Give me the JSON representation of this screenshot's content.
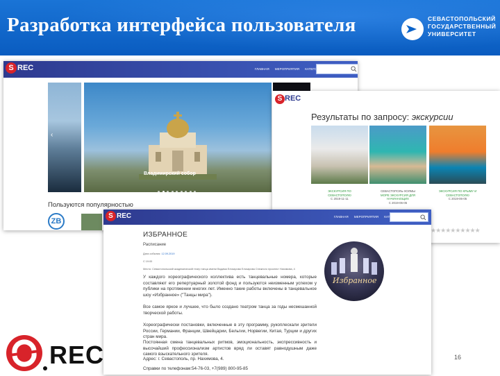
{
  "slide": {
    "title": "Разработка интерфейса пользователя",
    "university_lines": [
      "СЕВАСТОПОЛЬСКИЙ",
      "ГОСУДАРСТВЕННЫЙ",
      "УНИВЕРСИТЕТ"
    ],
    "page_number": "16",
    "footer_logo_text": "REC",
    "colors": {
      "banner": "#0b63c9",
      "nav": "#2e3a8f",
      "logo_red": "#d8232a"
    }
  },
  "shot1": {
    "logo": "REC",
    "nav": [
      "ГЛАВНАЯ",
      "МЕРОПРИЯТИЯ",
      "КАТЕГОРИИ"
    ],
    "hero_caption": "Владимирский собор",
    "section_title": "Пользуются популярностью",
    "popular_logo": "ZB"
  },
  "shot2": {
    "logo": "REC",
    "heading_prefix": "Результаты по запросу: ",
    "heading_query": "экскурсии",
    "results": [
      {
        "title_a": "ЭКСКУРСИЯ ПО",
        "title_b": "СЕВАСТОПОЛЮ",
        "date": "С 2019-11-11"
      },
      {
        "title_a": "СЕВАСТОПОЛЬ-ХОЛМЫ",
        "title_b": "МОРЕ ЭКСКУРСИЯ ДЛЯ НАЧИНАЮЩИХ",
        "date": "С 2019-06-05"
      },
      {
        "title_a": "ЭКСКУРСИЯ ПО КРЫМУ И",
        "title_b": "СЕВАСТОПОЛЮ",
        "date": "С 2019-06-05"
      }
    ],
    "rating_stars": "★★★★★★★★★★"
  },
  "shot3": {
    "logo": "REC",
    "nav": [
      "ГЛАВНАЯ",
      "МЕРОПРИЯТИЯ",
      "КАТЕГОРИИ"
    ],
    "title": "ИЗБРАННОЕ",
    "subtitle": "Расписание",
    "date_label": "Дата события: ",
    "date_value": "12.09.2019",
    "time": "С 19:00",
    "place": "Место: Севастопольский академический театр танца имени Вадима Елизарова Елизарова Снежного проспект Нахимова, 4",
    "paragraphs": [
      "У каждого хореографического коллектива есть танцевальные номера, которые составляют его репертуарный золотой фонд и пользуются неизменным успехом у публики на протяжении многих лет. Именно такие работы включены в танцевальное шоу «Избранное» (\"Танцы мира\").",
      "Все самое яркое и лучшее, что было создано театром танца за годы несмешанной творческой работы.",
      "Хореографически постановки, включенные в эту программу, рукоплескали зрители России, Германии, Франции, Швейцарии, Бельгии, Норвегии, Китая, Турции и других стран мира.",
      "Постоянная смена танцевальных ритмов, эмоциональность, экспрессивность и высочайший профессионализм артистов вряд ли оставят равнодушным даже самого взыскательного зрителя.",
      "Адрес: г. Севастополь, пр. Нахимова, 4.",
      "Справки по телефонам:54-76-03, +7(989) 800-95-85"
    ],
    "poster_text": "Избранное"
  }
}
